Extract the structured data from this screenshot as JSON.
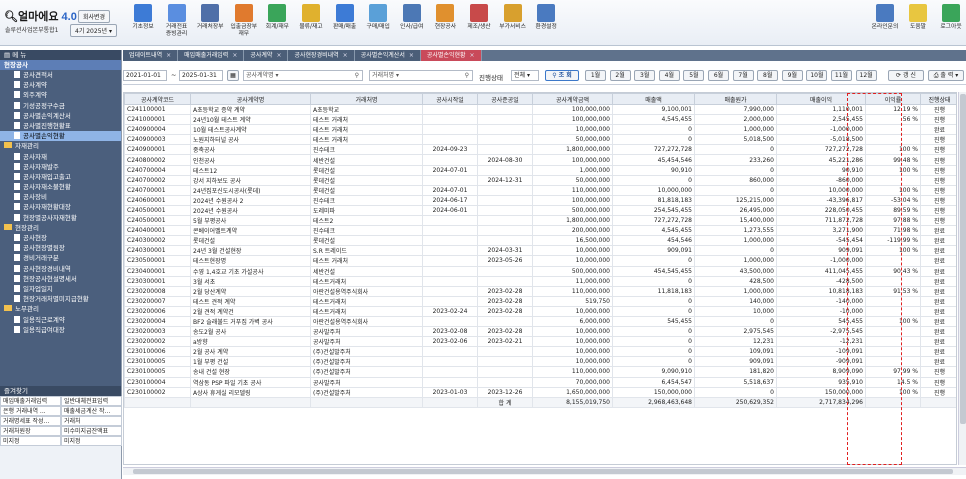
{
  "app": {
    "logo": "얼마에요",
    "version": "4.0",
    "company": "솔루션사업본부통합1",
    "period": "4기 2025년",
    "change_btn": "회사변경"
  },
  "toolbar": [
    {
      "label": "기초정보",
      "color": "#3d7bd6"
    },
    {
      "label": "거래전표\n증빙관리",
      "color": "#5a8ee0"
    },
    {
      "label": "거래처장부",
      "color": "#4f6fa8"
    },
    {
      "label": "입출금장부\n재무",
      "color": "#e07a2e"
    },
    {
      "label": "회계/재무",
      "color": "#3aa55a"
    },
    {
      "label": "물류/재고",
      "color": "#e0b12e"
    },
    {
      "label": "판매/매출",
      "color": "#3d7bd6"
    },
    {
      "label": "구매/매입",
      "color": "#5aa0d8"
    },
    {
      "label": "인사/급여",
      "color": "#4c78b5"
    },
    {
      "label": "현장공사",
      "color": "#e0902e"
    },
    {
      "label": "제조/생산",
      "color": "#c84a4a"
    },
    {
      "label": "부가서비스",
      "color": "#d8a02e"
    },
    {
      "label": "환경설정",
      "color": "#4a7ac0"
    }
  ],
  "toolbar_right": [
    {
      "label": "온라인문의",
      "color": "#4a7ac0"
    },
    {
      "label": "도움말",
      "color": "#e8c640"
    },
    {
      "label": "로그아웃",
      "color": "#3aa55a"
    }
  ],
  "sidebar": {
    "header": "메 뉴",
    "section": "현장공사",
    "items": [
      {
        "label": "공사견적서",
        "type": "doc"
      },
      {
        "label": "공사계약",
        "type": "doc"
      },
      {
        "label": "외주계약",
        "type": "doc"
      },
      {
        "label": "기성공정구수금",
        "type": "doc"
      },
      {
        "label": "공사별손익계산서",
        "type": "doc"
      },
      {
        "label": "공사별진행현황표",
        "type": "doc"
      },
      {
        "label": "공사별손익현황",
        "type": "doc",
        "selected": true
      },
      {
        "label": "자재관리",
        "type": "folder"
      },
      {
        "label": "공사자재",
        "type": "doc"
      },
      {
        "label": "공사자재발주",
        "type": "doc"
      },
      {
        "label": "공사자재입고출고",
        "type": "doc"
      },
      {
        "label": "공사자재소불현황",
        "type": "doc"
      },
      {
        "label": "공사장비",
        "type": "doc"
      },
      {
        "label": "공사자재현황대장",
        "type": "doc"
      },
      {
        "label": "현장별공사자재현황",
        "type": "doc"
      },
      {
        "label": "현장관리",
        "type": "folder"
      },
      {
        "label": "공사현장",
        "type": "doc"
      },
      {
        "label": "공사현장별원장",
        "type": "doc"
      },
      {
        "label": "경비거래구분",
        "type": "doc"
      },
      {
        "label": "공사현장경비내역",
        "type": "doc"
      },
      {
        "label": "현장공사현설명세서",
        "type": "doc"
      },
      {
        "label": "일자업일지",
        "type": "doc"
      },
      {
        "label": "현장거래처별미지급현황",
        "type": "doc"
      },
      {
        "label": "노무관리",
        "type": "folder"
      },
      {
        "label": "일용직근로계약",
        "type": "doc"
      },
      {
        "label": "일용직급여대장",
        "type": "doc"
      }
    ],
    "fav_header": "즐겨찾기",
    "favorites": [
      "매입매출거래입력",
      "일반대체전표입력",
      "은행 거래내역 ...",
      "매출세금계산 작...",
      "거래명세표 작성...",
      "거래처",
      "거래처원장",
      "미수미지급잔액표",
      "미지정",
      "미지정"
    ]
  },
  "tabs": [
    {
      "label": "업데이트내역",
      "active": false
    },
    {
      "label": "매입매출거래입력",
      "active": false
    },
    {
      "label": "공사계약",
      "active": false
    },
    {
      "label": "공사현장경비내역",
      "active": false
    },
    {
      "label": "공사별손익계산서",
      "active": false
    },
    {
      "label": "공사별손익현황",
      "active": true
    }
  ],
  "filters": {
    "date_from": "2021-01-01",
    "date_to": "2025-01-31",
    "contract_placeholder": "공사계약명",
    "client_placeholder": "거래처명",
    "status_label": "진행상태",
    "status_value": "전체",
    "search_btn": "조 회",
    "months": [
      "1월",
      "2월",
      "3월",
      "4월",
      "5월",
      "6월",
      "7월",
      "8월",
      "9월",
      "10월",
      "11월",
      "12월"
    ],
    "refresh_btn": "갱 신",
    "print_btn": "출 력"
  },
  "table": {
    "columns": [
      "공사계약코드",
      "공사계약명",
      "거래처명",
      "공사시작일",
      "공사준공일",
      "공사계약금액",
      "매출액",
      "매출원가",
      "매출이익",
      "이익률",
      "진행상태"
    ],
    "rows": [
      [
        "C241100001",
        "A초등학교 증약 계약",
        "A초등학교",
        "",
        "",
        "100,000,000",
        "9,100,001",
        "7,990,000",
        "1,110,001",
        "12.19 %",
        "진행"
      ],
      [
        "C241000001",
        "24년10월 테스트 계약",
        "테스트 거래처",
        "",
        "",
        "100,000,000",
        "4,545,455",
        "2,000,000",
        "2,545,455",
        "56 %",
        "진행"
      ],
      [
        "C240900004",
        "10월 테스트공사계약",
        "테스트 거래처",
        "",
        "",
        "10,000,000",
        "0",
        "1,000,000",
        "-1,000,000",
        "",
        "완료"
      ],
      [
        "C240900003",
        "노원지하터널 공사",
        "테스트 거래처",
        "",
        "",
        "50,000,000",
        "0",
        "5,018,500",
        "-5,018,500",
        "",
        "진행"
      ],
      [
        "C240900001",
        "중축공사",
        "진수테크",
        "2024-09-23",
        "",
        "1,800,000,000",
        "727,272,728",
        "0",
        "727,272,728",
        "100 %",
        "진행"
      ],
      [
        "C240800002",
        "인천공사",
        "세반건설",
        "",
        "2024-08-30",
        "100,000,000",
        "45,454,546",
        "233,260",
        "45,221,286",
        "99.48 %",
        "진행"
      ],
      [
        "C240700004",
        "테스트12",
        "롯데건설",
        "2024-07-01",
        "",
        "1,000,000",
        "90,910",
        "0",
        "90,910",
        "100 %",
        "진행"
      ],
      [
        "C240700002",
        "강서 지하보도 공사",
        "롯데건설",
        "",
        "2024-12-31",
        "50,000,000",
        "0",
        "860,000",
        "-860,000",
        "",
        "진행"
      ],
      [
        "C240700001",
        "24년집포신도시공사(롯데)",
        "롯데건설",
        "2024-07-01",
        "",
        "110,000,000",
        "10,000,000",
        "0",
        "10,000,000",
        "100 %",
        "진행"
      ],
      [
        "C240600001",
        "2024년 수원공사 2",
        "진수테크",
        "2024-06-17",
        "",
        "100,000,000",
        "81,818,183",
        "125,215,000",
        "-43,396,817",
        "-53.04 %",
        "진행"
      ],
      [
        "C240500001",
        "2024년 수원공사",
        "도레미파",
        "2024-06-01",
        "",
        "500,000,000",
        "254,545,455",
        "26,495,000",
        "228,050,455",
        "89.59 %",
        "진행"
      ],
      [
        "C240500001",
        "5월 부평공사",
        "테스트2",
        "",
        "",
        "1,800,000,000",
        "727,272,728",
        "15,400,000",
        "711,872,728",
        "97.88 %",
        "진행"
      ],
      [
        "C240400001",
        "콘베이어벨트계약",
        "진수테크",
        "",
        "",
        "200,000,000",
        "4,545,455",
        "1,273,555",
        "3,271,900",
        "71.98 %",
        "완료"
      ],
      [
        "C240300002",
        "롯데건설",
        "롯데건설",
        "",
        "",
        "16,500,000",
        "454,546",
        "1,000,000",
        "-545,454",
        "-119.99 %",
        "완료"
      ],
      [
        "C240300001",
        "24년 3월 건설현장",
        "S.R 트레이드",
        "",
        "2024-03-31",
        "10,000,000",
        "909,091",
        "0",
        "909,091",
        "100 %",
        "완료"
      ],
      [
        "C230500001",
        "테스트현장명",
        "테스트 거래처",
        "",
        "2023-05-26",
        "10,000,000",
        "0",
        "1,000,000",
        "-1,000,000",
        "",
        "완료"
      ],
      [
        "C230400001",
        "수영 1,4호교 기초 가설공사",
        "세반건설",
        "",
        "",
        "500,000,000",
        "454,545,455",
        "43,500,000",
        "411,045,455",
        "90.43 %",
        "완료"
      ],
      [
        "C230300001",
        "3월 서초",
        "테스트거래처",
        "",
        "",
        "11,000,000",
        "0",
        "428,500",
        "-428,500",
        "",
        "완료"
      ],
      [
        "C230200008",
        "2월 당산계약",
        "아란건설용역주식회사",
        "",
        "2023-02-28",
        "110,000,000",
        "11,818,183",
        "1,000,000",
        "10,818,183",
        "91.53 %",
        "완료"
      ],
      [
        "C230200007",
        "테스트 견적 계약",
        "테스트거래처",
        "",
        "2023-02-28",
        "519,750",
        "0",
        "140,000",
        "-140,000",
        "",
        "완료"
      ],
      [
        "C230200006",
        "2월 견적 계약건",
        "테스트거래처",
        "2023-02-24",
        "2023-02-28",
        "10,000,000",
        "0",
        "10,000",
        "-10,000",
        "",
        "완료"
      ],
      [
        "C230200004",
        "BF2 슬래불드 거푸집 가벽 공사",
        "아란건설용역주식회사",
        "",
        "",
        "6,000,000",
        "545,455",
        "0",
        "545,455",
        "100 %",
        "완료"
      ],
      [
        "C230200003",
        "송도2월 공사",
        "공사발주처",
        "2023-02-08",
        "2023-02-28",
        "10,000,000",
        "0",
        "2,975,545",
        "-2,975,545",
        "",
        "완료"
      ],
      [
        "C230200002",
        "a방향",
        "공사발주처",
        "2023-02-06",
        "2023-02-21",
        "10,000,000",
        "0",
        "12,231",
        "-12,231",
        "",
        "완료"
      ],
      [
        "C230100006",
        "2월 공사 계약",
        "(주)건설발주처",
        "",
        "",
        "10,000,000",
        "0",
        "109,091",
        "-109,091",
        "",
        "완료"
      ],
      [
        "C230100005",
        "1월 부평 건설",
        "(주)건설발주처",
        "",
        "",
        "10,000,000",
        "0",
        "909,091",
        "-909,091",
        "",
        "완료"
      ],
      [
        "C230100005",
        "송내 건설 현장",
        "(주)건설발주처",
        "",
        "",
        "110,000,000",
        "9,090,910",
        "181,820",
        "8,909,090",
        "97.99 %",
        "진행"
      ],
      [
        "C230100004",
        "역삼동 PSP 파일 기초 공사",
        "공사발주처",
        "",
        "",
        "70,000,000",
        "6,454,547",
        "5,518,637",
        "935,910",
        "14.5 %",
        "진행"
      ],
      [
        "C230100002",
        "A상사 휴게실 리모델링",
        "(주)건설발주처",
        "2023-01-03",
        "2023-12-26",
        "1,650,000,000",
        "150,000,000",
        "0",
        "150,000,000",
        "100 %",
        "진행"
      ]
    ],
    "total_label": "합 계",
    "totals": [
      "8,155,019,750",
      "2,968,463,648",
      "250,629,352",
      "2,717,834,296"
    ]
  }
}
